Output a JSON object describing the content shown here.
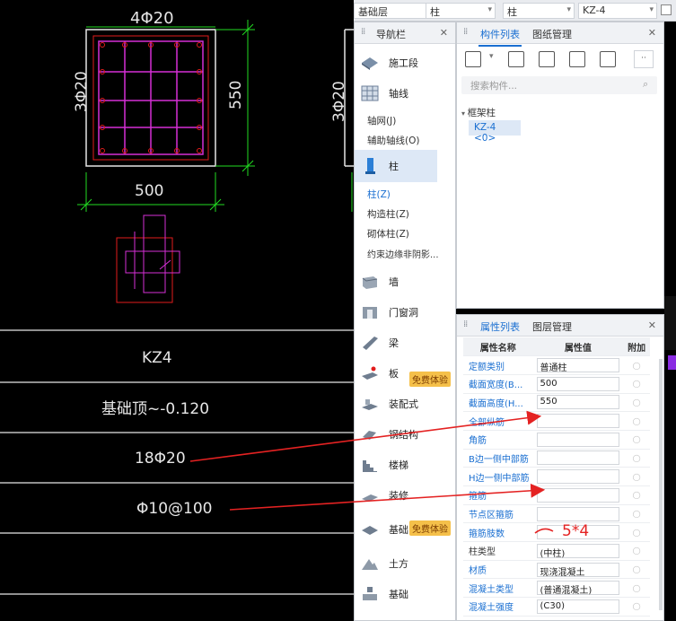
{
  "drawing": {
    "top_rebar": "4Φ20",
    "left_rebar": "3Φ20",
    "right_rebar_partial": "3Φ20",
    "width_dim": "500",
    "height_dim": "550",
    "table_rows": [
      "KZ4",
      "基础顶~-0.120",
      "18Φ20",
      "Φ10@100"
    ]
  },
  "topbar": {
    "floor": "基础层",
    "type1": "柱",
    "type2": "柱",
    "component": "KZ-4"
  },
  "nav": {
    "title": "导航栏",
    "items": [
      {
        "label": "施工段"
      },
      {
        "label": "轴线"
      },
      {
        "label": "柱"
      },
      {
        "label": "墙"
      },
      {
        "label": "门窗洞"
      },
      {
        "label": "梁"
      },
      {
        "label": "板"
      },
      {
        "label": "装配式"
      },
      {
        "label": "钢结构"
      },
      {
        "label": "楼梯"
      },
      {
        "label": "装修"
      },
      {
        "label": "基础"
      },
      {
        "label": "土方"
      },
      {
        "label": "基础"
      }
    ],
    "axis_sub": [
      "轴网(J)",
      "辅助轴线(O)"
    ],
    "col_sub": [
      "柱(Z)",
      "构造柱(Z)",
      "砌体柱(Z)",
      "约束边缘非阴影..."
    ],
    "badge1": "免费体验",
    "badge2": "免费体验"
  },
  "components": {
    "tab_active": "构件列表",
    "tab_other": "图纸管理",
    "search_placeholder": "搜索构件...",
    "tree_root": "框架柱",
    "tree_item": "KZ-4 <0>",
    "more": "··"
  },
  "properties": {
    "tab_active": "属性列表",
    "tab_other": "图层管理",
    "headers": [
      "属性名称",
      "属性值",
      "附加"
    ],
    "rows": [
      {
        "name": "定额类别",
        "value": "普通柱",
        "plain": false
      },
      {
        "name": "截面宽度(B...",
        "value": "500",
        "plain": false
      },
      {
        "name": "截面高度(H...",
        "value": "550",
        "plain": false
      },
      {
        "name": "全部纵筋",
        "value": "",
        "plain": false
      },
      {
        "name": "角筋",
        "value": "",
        "plain": false
      },
      {
        "name": "B边一侧中部筋",
        "value": "",
        "plain": false
      },
      {
        "name": "H边一侧中部筋",
        "value": "",
        "plain": false
      },
      {
        "name": "箍筋",
        "value": "",
        "plain": false
      },
      {
        "name": "节点区箍筋",
        "value": "",
        "plain": false
      },
      {
        "name": "箍筋肢数",
        "value": "",
        "plain": false
      },
      {
        "name": "柱类型",
        "value": "(中柱)",
        "plain": true
      },
      {
        "name": "材质",
        "value": "现浇混凝土",
        "plain": false
      },
      {
        "name": "混凝土类型",
        "value": "(普通混凝土)",
        "plain": false
      },
      {
        "name": "混凝土强度",
        "value": "(C30)",
        "plain": false
      }
    ],
    "annotation": "5*4"
  },
  "colors": {
    "cad_bg": "#000000",
    "magenta": "#d62fd6",
    "green": "#22dd22",
    "red": "#e21c1c",
    "accent": "#1a6fd1"
  }
}
